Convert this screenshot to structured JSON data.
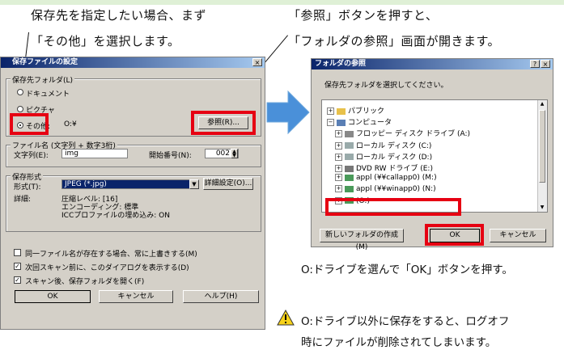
{
  "captions": {
    "left_line1": "保存先を指定したい場合、まず",
    "left_line2": "「その他」を選択します。",
    "right_line1": "「参照」ボタンを押すと、",
    "right_line2": "「フォルダの参照」画面が開きます。"
  },
  "dialog1": {
    "title": "保存ファイルの設定",
    "close": "×",
    "save_folder_group": "保存先フォルダ(L)",
    "radio_documents": "ドキュメント",
    "radio_pictures": "ピクチャ",
    "radio_other": "その他:",
    "other_path": "O:¥",
    "browse_button": "参照(R)...",
    "filename_group": "ファイル名 (文字列 + 数字3桁)",
    "string_label": "文字列(E):",
    "string_value": "img",
    "start_number_label": "開始番号(N):",
    "start_number_value": "002",
    "format_group": "保存形式",
    "format_label": "形式(T):",
    "format_value": "JPEG (*.jpg)",
    "detail_button": "詳細設定(O)...",
    "detail_label": "詳細:",
    "detail_line1": "圧縮レベル: [16]",
    "detail_line2": "エンコーディング: 標準",
    "detail_line3": "ICCプロファイルの埋め込み: ON",
    "check_overwrite": "同一ファイル名が存在する場合、常に上書きする(M)",
    "check_show_dialog": "次回スキャン前に、このダイアログを表示する(D)",
    "check_open_folder": "スキャン後、保存フォルダを開く(F)",
    "ok": "OK",
    "cancel": "キャンセル",
    "help": "ヘルプ(H)"
  },
  "dialog2": {
    "title": "フォルダの参照",
    "help_button": "?",
    "close": "×",
    "instruction": "保存先フォルダを選択してください。",
    "tree": [
      {
        "label": "パブリック",
        "icon": "folder-icon",
        "indent": 0
      },
      {
        "label": "コンピュータ",
        "icon": "computer-icon",
        "indent": 0
      },
      {
        "label": "フロッピー ディスク ドライブ (A:)",
        "icon": "floppy-icon",
        "indent": 1
      },
      {
        "label": "ローカル ディスク (C:)",
        "icon": "disk-icon",
        "indent": 1
      },
      {
        "label": "ローカル ディスク (D:)",
        "icon": "disk-icon",
        "indent": 1
      },
      {
        "label": "DVD RW ドライブ (E:)",
        "icon": "dvd-icon",
        "indent": 1
      },
      {
        "label": "appl (¥¥callapp0) (M:)",
        "icon": "network-drive-icon",
        "indent": 1
      },
      {
        "label": "appl (¥¥winapp0) (N:)",
        "icon": "network-drive-icon",
        "indent": 1
      },
      {
        "label": "(O:)",
        "icon": "network-drive-icon",
        "indent": 1
      }
    ],
    "new_folder_button": "新しいフォルダの作成(M)",
    "ok": "OK",
    "cancel": "キャンセル"
  },
  "notes": {
    "instruction": "O:ドライブを選んで「OK」ボタンを押す。",
    "warning_line1": "O:ドライブ以外に保存をすると、ログオフ",
    "warning_line2": "時にファイルが削除されてしまいます。",
    "warning_icon": "warning-icon"
  },
  "colors": {
    "highlight_box": "#e60012",
    "arrow": "#4a90d9",
    "titlebar": "#0a246a"
  }
}
